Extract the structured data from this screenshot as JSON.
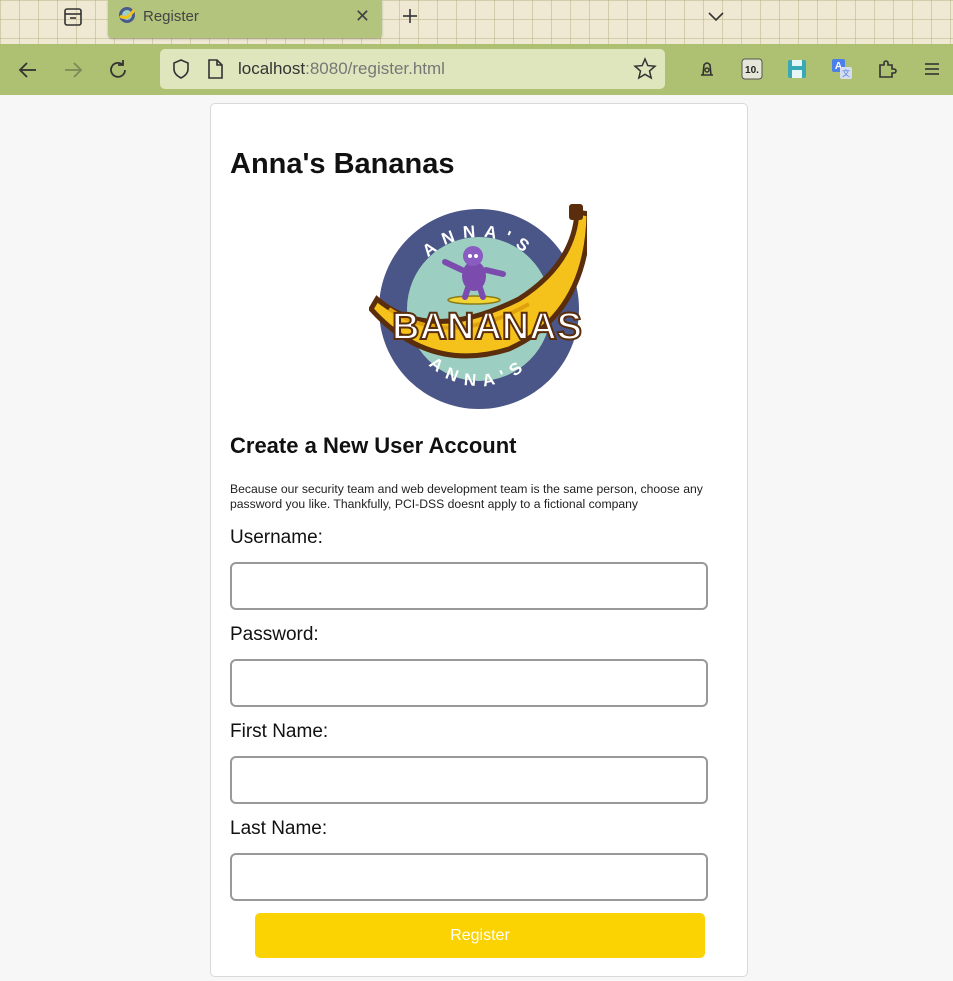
{
  "browser": {
    "tab_title": "Register",
    "url_host": "localhost",
    "url_rest": ":8080/register.html",
    "theme_colors": {
      "tabbar": "#efe9d4",
      "tab": "#b3c47d",
      "navbar": "#aec072",
      "urlbar": "#dfe6bd"
    }
  },
  "page": {
    "site_title": "Anna's Bananas",
    "logo": {
      "ring_top_text": "ANNA'S",
      "ring_bottom_text": "ANNA'S",
      "center_text": "BANANAS"
    },
    "section_title": "Create a New User Account",
    "note": "Because our security team and web development team is the same person, choose any password you like. Thankfully, PCI-DSS doesnt apply to a fictional company",
    "form": {
      "username_label": "Username:",
      "username_value": "",
      "password_label": "Password:",
      "password_value": "",
      "first_name_label": "First Name:",
      "first_name_value": "",
      "last_name_label": "Last Name:",
      "last_name_value": "",
      "submit_label": "Register"
    },
    "colors": {
      "button": "#fcd302",
      "button_text": "#ffffff"
    }
  }
}
